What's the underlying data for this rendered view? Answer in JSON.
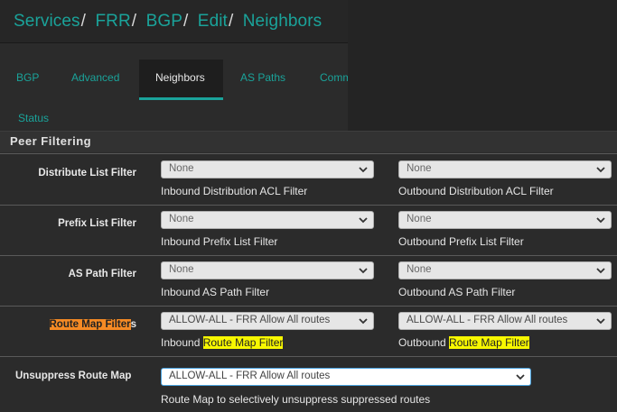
{
  "breadcrumb": [
    "Services",
    "FRR",
    "BGP",
    "Edit",
    "Neighbors"
  ],
  "tabs": [
    {
      "label": "BGP",
      "active": false
    },
    {
      "label": "Advanced",
      "active": false
    },
    {
      "label": "Neighbors",
      "active": true
    },
    {
      "label": "AS Paths",
      "active": false
    },
    {
      "label": "Comm",
      "active": false
    },
    {
      "label": "Status",
      "active": false
    }
  ],
  "panel_title": "Peer Filtering",
  "rows": [
    {
      "label": "Distribute List Filter",
      "inbound_value": "None",
      "inbound_help": "Inbound Distribution ACL Filter",
      "outbound_value": "None",
      "outbound_help": "Outbound Distribution ACL Filter"
    },
    {
      "label": "Prefix List Filter",
      "inbound_value": "None",
      "inbound_help": "Inbound Prefix List Filter",
      "outbound_value": "None",
      "outbound_help": "Outbound Prefix List Filter"
    },
    {
      "label": "AS Path Filter",
      "inbound_value": "None",
      "inbound_help": "Inbound AS Path Filter",
      "outbound_value": "None",
      "outbound_help": "Outbound AS Path Filter"
    },
    {
      "label_highlight": "Route Map Filter",
      "label_rest": "s",
      "inbound_value": "ALLOW-ALL - FRR Allow All routes",
      "inbound_help_prefix": "Inbound ",
      "inbound_help_highlight": "Route Map Filter",
      "outbound_value": "ALLOW-ALL - FRR Allow All routes",
      "outbound_help_prefix": "Outbound ",
      "outbound_help_highlight": "Route Map Filter"
    }
  ],
  "unsuppress": {
    "label": "Unsuppress Route Map",
    "value": "ALLOW-ALL - FRR Allow All routes",
    "help": "Route Map to selectively unsuppress suppressed routes"
  },
  "colors": {
    "accent": "#1aa39a",
    "highlight_yellow": "#f7f700",
    "highlight_orange": "#f58a24",
    "focus_border": "#4aa3df"
  },
  "icons": {
    "select_arrow": "chevron-down-icon"
  }
}
